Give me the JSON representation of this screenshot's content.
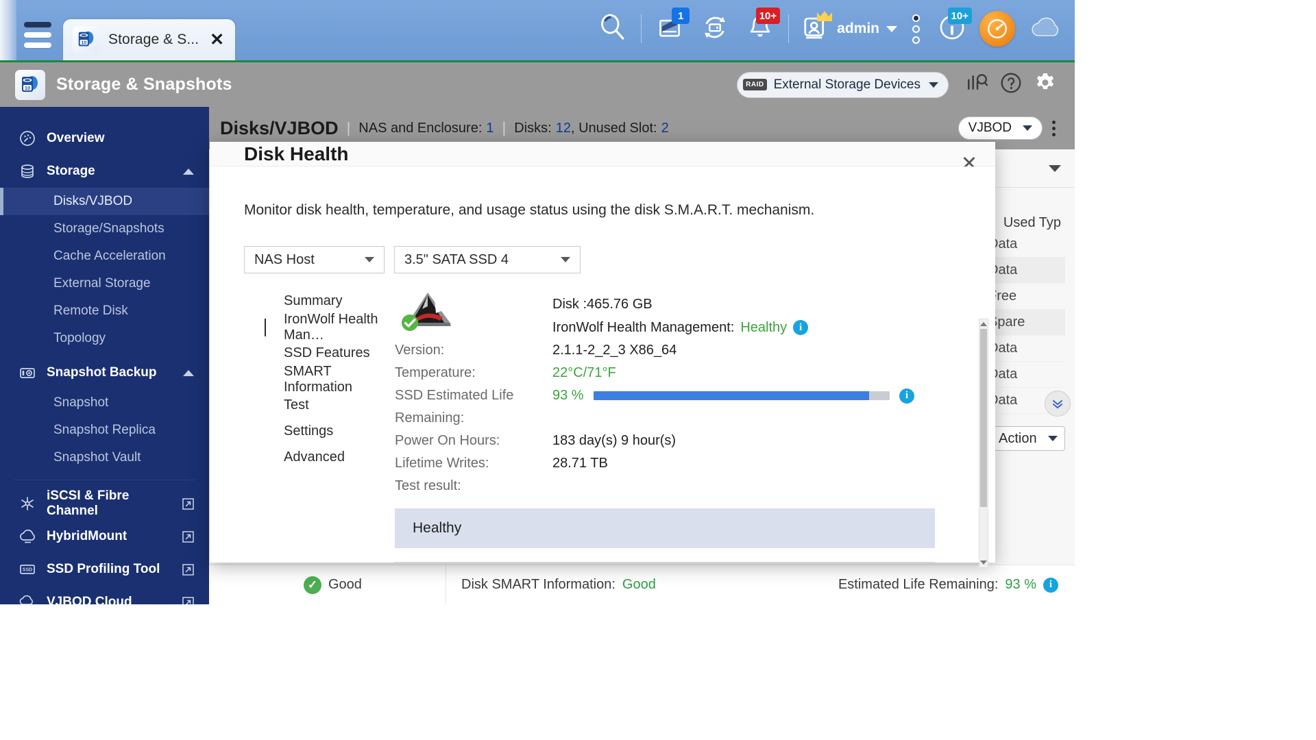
{
  "topbar": {
    "menu_icon": "hamburger-icon",
    "tab": {
      "label": "Storage & S...",
      "icon": "storage-snapshots-icon",
      "close": "✕"
    },
    "icons": [
      {
        "name": "search-icon",
        "badge": null
      },
      {
        "name": "backup-station-icon",
        "badge": "1",
        "badge_color": "blue"
      },
      {
        "name": "sync-disk-icon",
        "badge": null
      },
      {
        "name": "notification-bell-icon",
        "badge": "10+",
        "badge_color": "red"
      }
    ],
    "user": {
      "name": "admin",
      "icon": "user-badge-icon",
      "crown": "crown-icon",
      "caret": "▾"
    },
    "dots_icon": "more-options-icon",
    "info_icon": "info-icon",
    "info_badge": "10+",
    "dashboard_icon": "dashboard-gauge-icon",
    "cloud_icon": "cloud-icon"
  },
  "app_header": {
    "title": "Storage & Snapshots",
    "logo_icon": "storage-snapshots-icon",
    "external_storage": {
      "chip": "RAID",
      "label": "External Storage Devices",
      "caret": "▾"
    },
    "icons": [
      "analysis-icon",
      "help-icon",
      "settings-gear-icon"
    ]
  },
  "sidebar": {
    "items": [
      {
        "label": "Overview",
        "icon": "gauge-icon",
        "type": "group",
        "expandable": false
      },
      {
        "label": "Storage",
        "icon": "database-icon",
        "type": "group",
        "expandable": true
      },
      {
        "label": "Disks/VJBOD",
        "type": "sub",
        "active": true
      },
      {
        "label": "Storage/Snapshots",
        "type": "sub",
        "active": false
      },
      {
        "label": "Cache Acceleration",
        "type": "sub",
        "active": false
      },
      {
        "label": "External Storage",
        "type": "sub",
        "active": false
      },
      {
        "label": "Remote Disk",
        "type": "sub",
        "active": false
      },
      {
        "label": "Topology",
        "type": "sub",
        "active": false
      },
      {
        "label": "Snapshot Backup",
        "icon": "camera-icon",
        "type": "group",
        "expandable": true
      },
      {
        "label": "Snapshot",
        "type": "sub",
        "active": false
      },
      {
        "label": "Snapshot Replica",
        "type": "sub",
        "active": false
      },
      {
        "label": "Snapshot Vault",
        "type": "sub",
        "active": false
      }
    ],
    "external_items": [
      {
        "label": "iSCSI & Fibre Channel",
        "icon": "fibre-channel-icon",
        "ext": "external-link-icon"
      },
      {
        "label": "HybridMount",
        "icon": "hybridmount-icon",
        "ext": "external-link-icon"
      },
      {
        "label": "SSD Profiling Tool",
        "icon": "ssd-icon",
        "ext": "external-link-icon"
      },
      {
        "label": "VJBOD Cloud",
        "icon": "vjbod-cloud-icon",
        "ext": "external-link-icon"
      }
    ]
  },
  "breadcrumb": {
    "title": "Disks/VJBOD",
    "nas_label": "NAS and Enclosure:",
    "nas_value": "1",
    "disks_label": "Disks:",
    "disks_value": "12",
    "unused_label": ", Unused Slot:",
    "unused_value": "2",
    "vjbod_pill": "VJBOD",
    "vjbod_caret": "▾",
    "kebab_icon": "more-options-icon"
  },
  "table": {
    "column_header": "Used Typ",
    "used_cells": [
      "Data",
      "Data",
      "Free",
      "Spare",
      "Data",
      "Data",
      "Data"
    ],
    "action_label": "Action",
    "action_caret": "▾",
    "expand_icon": "double-chevron-down-icon"
  },
  "bottom_strip": {
    "good_label": "Good",
    "smart_label": "Disk SMART Information:",
    "smart_value": "Good",
    "life_label": "Estimated Life Remaining:",
    "life_value": "93 %",
    "info_icon": "info-icon"
  },
  "modal": {
    "title": "Disk Health",
    "close_label": "✕",
    "description": "Monitor disk health, temperature, and usage status using the disk S.M.A.R.T. mechanism.",
    "selects": [
      {
        "name": "host-select",
        "value": "NAS Host",
        "caret": "▾"
      },
      {
        "name": "disk-select",
        "value": "3.5\" SATA SSD 4",
        "caret": "▾"
      }
    ],
    "nav": [
      {
        "label": "Summary",
        "active": false
      },
      {
        "label": "IronWolf Health Man…",
        "active": true
      },
      {
        "label": "SSD Features",
        "active": false
      },
      {
        "label": "SMART Information",
        "active": false
      },
      {
        "label": "Test",
        "active": false
      },
      {
        "label": "Settings",
        "active": false
      },
      {
        "label": "Advanced",
        "active": false
      }
    ],
    "brand_icon": "seagate-ironwolf-icon",
    "status_check_icon": "green-check-icon",
    "disk_size_line": "Disk :465.76 GB",
    "ihm_label": "IronWolf Health Management:",
    "ihm_status": "Healthy",
    "ihm_info_icon": "info-icon",
    "fields": [
      {
        "label": "Version:",
        "value": "2.1.1-2_2_3 X86_64",
        "green": false
      },
      {
        "label": "Temperature:",
        "value": "22°C/71°F",
        "green": true
      }
    ],
    "ssd_life": {
      "label": "SSD Estimated Life",
      "label2": "Remaining:",
      "value": "93 %",
      "percent": 93,
      "bar_color": "#3d7fe0",
      "info_icon": "info-icon"
    },
    "power_on": {
      "label": "Power On Hours:",
      "value": "183 day(s) 9 hour(s)"
    },
    "lifetime_writes": {
      "label": "Lifetime Writes:",
      "value": "28.71 TB"
    },
    "test_result": {
      "label": "Test result:",
      "value": "Healthy"
    },
    "scrollbar": {
      "up": "scroll-up-arrow-icon",
      "down": "scroll-down-arrow-icon"
    }
  },
  "colors": {
    "accent_blue": "#3d7fe0",
    "success_green": "#3aa43a",
    "sidebar_navy": "#1a3071",
    "badge_red": "#d81f26",
    "info_cyan": "#17a3e0"
  }
}
